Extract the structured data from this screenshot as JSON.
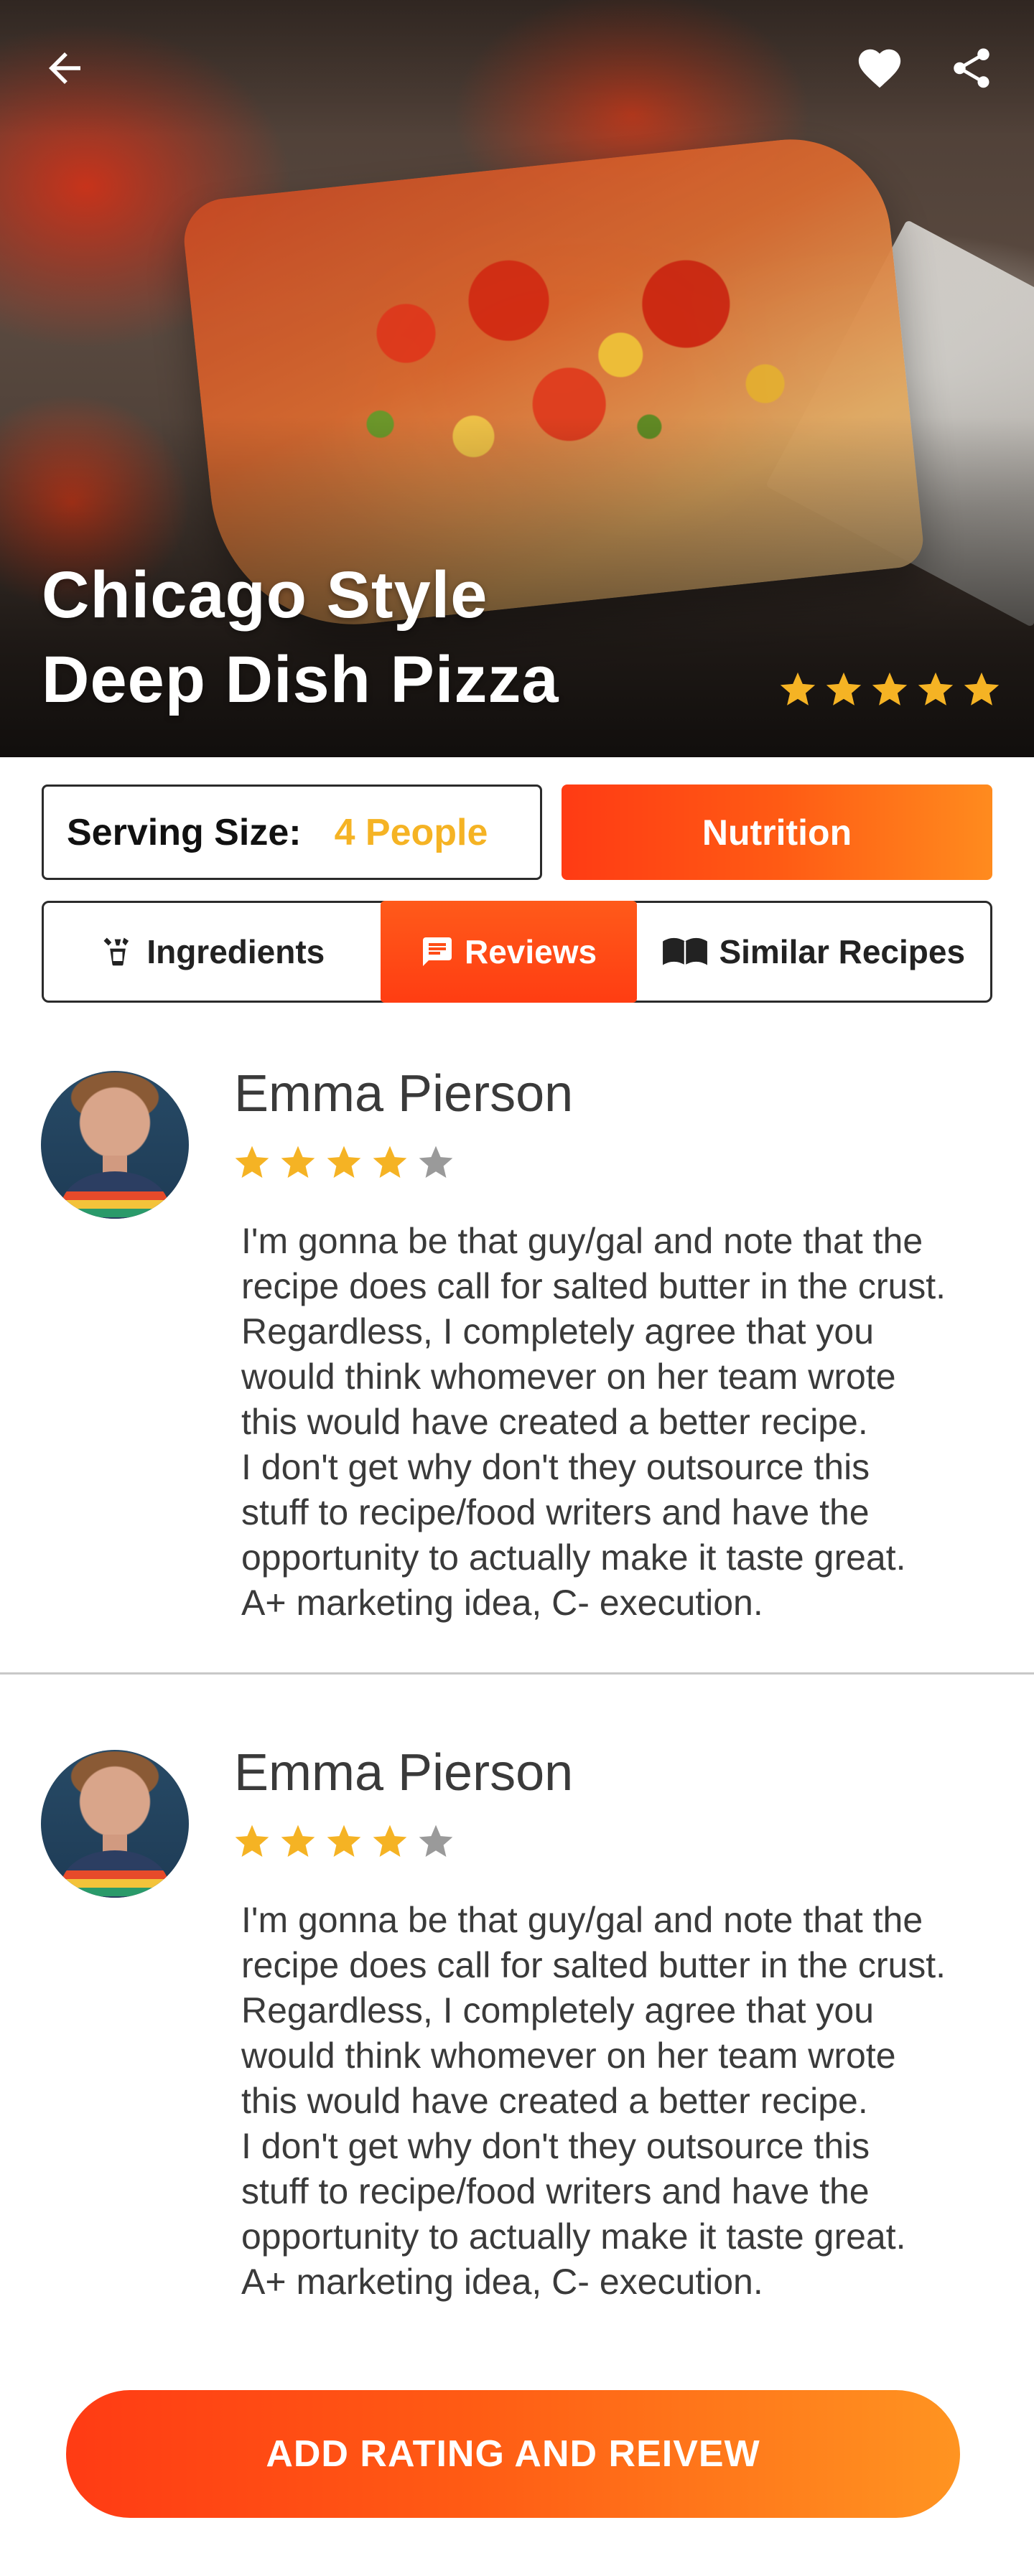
{
  "hero": {
    "title_line1": "Chicago Style",
    "title_line2": "Deep Dish Pizza",
    "rating": 5,
    "rating_max": 5
  },
  "topbar": {
    "back_icon": "arrow-left-icon",
    "favorite_icon": "heart-icon",
    "share_icon": "share-icon"
  },
  "serving": {
    "label": "Serving Size:",
    "value": "4 People"
  },
  "nutrition_button": "Nutrition",
  "tabs": [
    {
      "label": "Ingredients",
      "icon": "ingredients-icon",
      "active": false
    },
    {
      "label": "Reviews",
      "icon": "chat-icon",
      "active": true
    },
    {
      "label": "Similar Recipes",
      "icon": "recipes-icon",
      "active": false
    }
  ],
  "reviews": [
    {
      "name": "Emma Pierson",
      "rating": 4,
      "rating_max": 5,
      "text_lines": [
        "I'm gonna be that guy/gal and note that the",
        "recipe does call for salted butter in the crust.",
        "Regardless, I completely agree that you",
        "would think whomever on her team wrote",
        "this would have created a better recipe.",
        "I don't get why don't they outsource this",
        "stuff to recipe/food writers and have the",
        "opportunity to actually make it taste great.",
        "A+ marketing idea, C- execution."
      ]
    },
    {
      "name": "Emma Pierson",
      "rating": 4,
      "rating_max": 5,
      "text_lines": [
        "I'm gonna be that guy/gal and note that the",
        "recipe does call for salted butter in the crust.",
        "Regardless, I completely agree that you",
        "would think whomever on her team wrote",
        "this would have created a better recipe.",
        "I don't get why don't they outsource this",
        "stuff to recipe/food writers and have the",
        "opportunity to actually make it taste great.",
        "A+ marketing idea, C- execution."
      ]
    }
  ],
  "cta_button": "ADD RATING AND REIVEW",
  "colors": {
    "accent_start": "#ff3b14",
    "accent_end": "#ff9421",
    "star_filled": "#f5b324",
    "star_empty": "#9a9a9a",
    "serving_value": "#f5b324"
  }
}
